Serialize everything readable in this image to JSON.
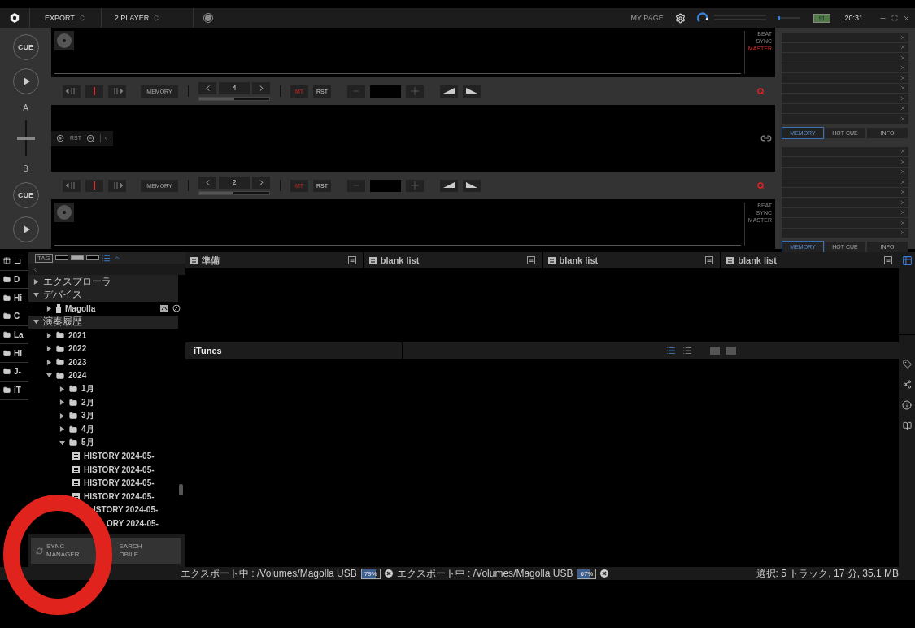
{
  "topbar": {
    "mode": "EXPORT",
    "layout": "2 PLAYER",
    "mypage": "MY PAGE",
    "battery": "91",
    "time": "20:31"
  },
  "side_panel": [
    {
      "kind": "cue",
      "text": "CUE"
    },
    {
      "kind": "play"
    },
    {
      "kind": "label",
      "text": "A"
    },
    {
      "kind": "fader",
      "level": 0.5
    },
    {
      "kind": "label",
      "text": "B"
    },
    {
      "kind": "cue",
      "text": "CUE"
    },
    {
      "kind": "play"
    }
  ],
  "decks": [
    {
      "beat": "BEAT",
      "sync": "SYNC",
      "master": "MASTER",
      "master_on": true,
      "memory": "MEMORY",
      "page": "4",
      "level": 0.5,
      "mt": "MT",
      "rst": "RST"
    },
    {
      "beat": "BEAT",
      "sync": "SYNC",
      "master": "MASTER",
      "master_on": false,
      "memory": "MEMORY",
      "page": "2",
      "level": 0.49,
      "mt": "MT",
      "rst": "RST"
    }
  ],
  "zoom": {
    "reset": "RST"
  },
  "hotcue_panels": [
    {
      "tabs": [
        {
          "label": "MEMORY",
          "selected": true
        },
        {
          "label": "HOT CUE",
          "selected": false
        },
        {
          "label": "INFO",
          "selected": false
        }
      ]
    },
    {
      "tabs": [
        {
          "label": "MEMORY",
          "selected": true
        },
        {
          "label": "HOT CUE",
          "selected": false
        },
        {
          "label": "INFO",
          "selected": false
        }
      ]
    }
  ],
  "browser": {
    "side_tabs": [
      {
        "kind": "grid",
        "label": "コ"
      },
      {
        "kind": "folder",
        "label": "D"
      },
      {
        "kind": "folder",
        "label": "Hi"
      },
      {
        "kind": "folder",
        "label": "C"
      },
      {
        "kind": "folder",
        "label": "La"
      },
      {
        "kind": "folder",
        "label": "Hi"
      },
      {
        "kind": "folder",
        "label": "J-"
      },
      {
        "kind": "folder",
        "label": "iT"
      }
    ],
    "tag": "TAG",
    "view_options": [
      {
        "selected": false
      },
      {
        "selected": true
      },
      {
        "selected": false
      }
    ],
    "tree": [
      {
        "kind": "section",
        "label": "エクスプローラ",
        "expanded": false
      },
      {
        "kind": "section",
        "label": "デバイス",
        "expanded": true,
        "children": [
          {
            "kind": "device",
            "label": "Magolla",
            "expanded": false
          }
        ]
      },
      {
        "kind": "section",
        "label": "演奏履歴",
        "expanded": true,
        "children": [
          {
            "kind": "folder",
            "label": "2021",
            "expanded": false
          },
          {
            "kind": "folder",
            "label": "2022",
            "expanded": false
          },
          {
            "kind": "folder",
            "label": "2023",
            "expanded": false
          },
          {
            "kind": "folder",
            "label": "2024",
            "expanded": true,
            "children": [
              {
                "kind": "folder",
                "label": "1月",
                "expanded": false
              },
              {
                "kind": "folder",
                "label": "2月",
                "expanded": false
              },
              {
                "kind": "folder",
                "label": "3月",
                "expanded": false
              },
              {
                "kind": "folder",
                "label": "4月",
                "expanded": false
              },
              {
                "kind": "folder",
                "label": "5月",
                "expanded": true,
                "children": [
                  {
                    "kind": "history",
                    "label": "HISTORY 2024-05-"
                  },
                  {
                    "kind": "history",
                    "label": "HISTORY 2024-05-"
                  },
                  {
                    "kind": "history",
                    "label": "HISTORY 2024-05-"
                  },
                  {
                    "kind": "history",
                    "label": "HISTORY 2024-05-"
                  },
                  {
                    "kind": "history_cut",
                    "label": "ISTORY 2024-05-"
                  },
                  {
                    "kind": "history_cut_more",
                    "label": "ORY 2024-05-"
                  }
                ]
              }
            ]
          }
        ]
      }
    ],
    "sync_manager": [
      "SYNC",
      "MANAGER"
    ],
    "search_mobile": [
      "EARCH",
      "OBILE"
    ],
    "palettes": [
      {
        "title": "準備"
      },
      {
        "title": "blank list"
      },
      {
        "title": "blank list"
      },
      {
        "title": "blank list"
      }
    ],
    "collection": {
      "title": "iTunes"
    }
  },
  "status": {
    "exports": [
      {
        "text": "エクスポート中 : /Volumes/Magolla USB",
        "percent": "79%",
        "level": 0.79
      },
      {
        "text": "エクスポート中 : /Volumes/Magolla USB",
        "percent": "67%",
        "level": 0.67
      }
    ],
    "selection": "選択: 5 トラック, 17 分, 35.1 MB"
  }
}
